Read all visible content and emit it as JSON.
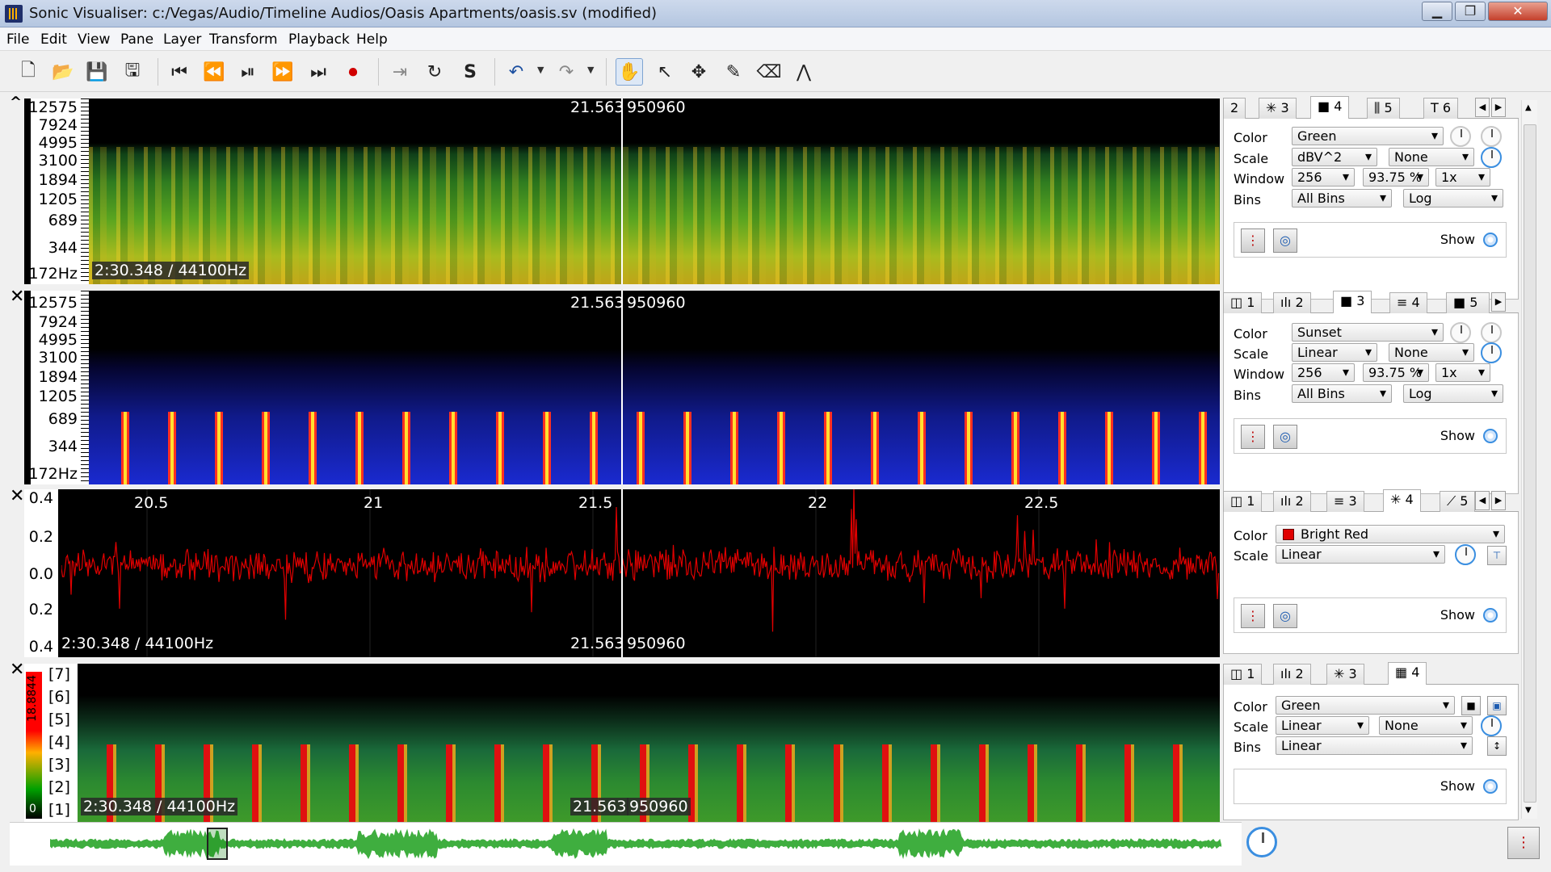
{
  "window": {
    "title": "Sonic Visualiser: c:/Vegas/Audio/Timeline Audios/Oasis Apartments/oasis.sv (modified)",
    "minimize": "▁",
    "maximize": "❐",
    "close": "✕"
  },
  "menu": [
    "File",
    "Edit",
    "View",
    "Pane",
    "Layer",
    "Transform",
    "Playback",
    "Help"
  ],
  "toolbar": {
    "icons": [
      "new-file-icon",
      "open-file-icon",
      "save-icon",
      "save-as-icon",
      "rewind-start-icon",
      "rewind-icon",
      "play-pause-icon",
      "fast-forward-icon",
      "fast-forward-end-icon",
      "record-icon",
      "play-selection-icon",
      "loop-icon",
      "solo-icon",
      "undo-icon",
      "redo-icon",
      "navigate-hand-icon",
      "select-arrow-icon",
      "move-icon",
      "draw-pencil-icon",
      "erase-icon",
      "measure-icon"
    ]
  },
  "colors": {
    "pane1": "#000000",
    "wave": "#e00000",
    "accent": "#3a8ee0",
    "overview_wave": "#3fae3f"
  },
  "panes": [
    {
      "freq_ticks": [
        "12575",
        "7924",
        "4995",
        "3100",
        "1894",
        "1205",
        "689",
        "344",
        "172Hz"
      ],
      "time": "21.563",
      "frame": "950960",
      "rate": "2:30.348 / 44100Hz",
      "close": "^"
    },
    {
      "freq_ticks": [
        "12575",
        "7924",
        "4995",
        "3100",
        "1894",
        "1205",
        "689",
        "344",
        "172Hz"
      ],
      "time": "21.563",
      "frame": "950960",
      "close": "✕"
    },
    {
      "amp_ticks": [
        "0.4",
        "0.2",
        "0.0",
        "0.2",
        "0.4"
      ],
      "time_ticks": [
        "20.5",
        "21",
        "21.5",
        "22",
        "22.5"
      ],
      "rate": "2:30.348 / 44100Hz",
      "time": "21.563",
      "frame": "950960",
      "close": "✕"
    },
    {
      "bins": [
        "[7]",
        "[6]",
        "[5]",
        "[4]",
        "[3]",
        "[2]",
        "[1]"
      ],
      "scale_max": "18.8844",
      "scale_min": "0",
      "rate": "2:30.348 / 44100Hz",
      "time": "21.563",
      "frame": "950960",
      "close": "✕"
    }
  ],
  "panels": [
    {
      "tabs": [
        {
          "icon": "",
          "num": "2"
        },
        {
          "icon": "✳",
          "num": "3"
        },
        {
          "icon": "■",
          "num": "4",
          "selected": true
        },
        {
          "icon": "⫼",
          "num": "5"
        },
        {
          "icon": "T",
          "num": "6"
        }
      ],
      "color_label": "Color",
      "color_value": "Green",
      "scale_label": "Scale",
      "scale_value": "dBV^2",
      "scale_value2": "None",
      "window_label": "Window",
      "window_value": "256",
      "window_overlap": "93.75 %",
      "window_zoom": "1x",
      "bins_label": "Bins",
      "bins_value": "All Bins",
      "bins_scale": "Log",
      "show_label": "Show"
    },
    {
      "tabs": [
        {
          "icon": "◫",
          "num": "1"
        },
        {
          "icon": "ılı",
          "num": "2"
        },
        {
          "icon": "■",
          "num": "3",
          "selected": true
        },
        {
          "icon": "≡",
          "num": "4"
        },
        {
          "icon": "■",
          "num": "5"
        }
      ],
      "color_label": "Color",
      "color_value": "Sunset",
      "scale_label": "Scale",
      "scale_value": "Linear",
      "scale_value2": "None",
      "window_label": "Window",
      "window_value": "256",
      "window_overlap": "93.75 %",
      "window_zoom": "1x",
      "bins_label": "Bins",
      "bins_value": "All Bins",
      "bins_scale": "Log",
      "show_label": "Show"
    },
    {
      "tabs": [
        {
          "icon": "◫",
          "num": "1"
        },
        {
          "icon": "ılı",
          "num": "2"
        },
        {
          "icon": "≡",
          "num": "3"
        },
        {
          "icon": "✳",
          "num": "4",
          "selected": true
        },
        {
          "icon": "⟋",
          "num": "5"
        }
      ],
      "color_label": "Color",
      "color_value": "Bright Red",
      "scale_label": "Scale",
      "scale_value": "Linear",
      "show_label": "Show"
    },
    {
      "tabs": [
        {
          "icon": "◫",
          "num": "1"
        },
        {
          "icon": "ılı",
          "num": "2"
        },
        {
          "icon": "✳",
          "num": "3"
        },
        {
          "icon": "▦",
          "num": "4",
          "selected": true
        }
      ],
      "color_label": "Color",
      "color_value": "Green",
      "scale_label": "Scale",
      "scale_value": "Linear",
      "scale_value2": "None",
      "bins_label": "Bins",
      "bins_value": "Linear",
      "show_label": "Show"
    }
  ]
}
